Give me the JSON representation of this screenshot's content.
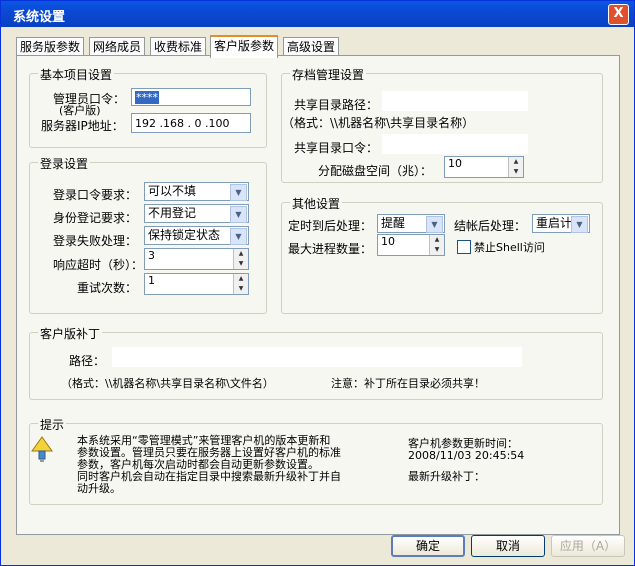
{
  "window": {
    "title": "系统设置",
    "close_glyph": "X"
  },
  "tabs": [
    "服务版参数",
    "网络成员",
    "收费标准",
    "客户版参数",
    "高级设置"
  ],
  "basic": {
    "title": "基本项目设置",
    "admin_pw_label": "管理员口令：",
    "admin_pw_sub": "(客户版)",
    "admin_pw_value": "****",
    "server_ip_label": "服务器IP地址：",
    "server_ip_value": "192 .168 . 0  .100"
  },
  "login": {
    "title": "登录设置",
    "pw_req_label": "登录口令要求：",
    "pw_req_value": "可以不填",
    "id_reg_label": "身份登记要求：",
    "id_reg_value": "不用登记",
    "fail_label": "登录失败处理：",
    "fail_value": "保持锁定状态",
    "timeout_label": "响应超时（秒）：",
    "timeout_value": "3",
    "retry_label": "重试次数：",
    "retry_value": "1"
  },
  "archive": {
    "title": "存档管理设置",
    "share_path_label": "共享目录路径：",
    "format_hint": "（格式：\\\\机器名称\\共享目录名称）",
    "share_pw_label": "共享目录口令：",
    "disk_label": "分配磁盘空间（兆）：",
    "disk_value": "10"
  },
  "other": {
    "title": "其他设置",
    "timer_label": "定时到后处理：",
    "timer_value": "提醒",
    "checkout_label": "结帐后处理：",
    "checkout_value": "重启计",
    "max_proc_label": "最大进程数量：",
    "max_proc_value": "10",
    "shell_label": "禁止Shell访问"
  },
  "patch": {
    "title": "客户版补丁",
    "path_label": "路径：",
    "format_hint": "（格式：\\\\机器名称\\共享目录名称\\文件名）",
    "note": "注意：补丁所在目录必须共享！"
  },
  "hint": {
    "title": "提示",
    "text1": "本系统采用“零管理模式”来管理客户机的版本更新和",
    "text2": "参数设置。管理员只要在服务器上设置好客户机的标准",
    "text3": "参数，客户机每次启动时都会自动更新参数设置。",
    "text4": "同时客户机会自动在指定目录中搜索最新升级补丁并自",
    "text5": "动升级。",
    "update_label": "客户机参数更新时间：",
    "update_value": "2008/11/03 20:45:54",
    "latest_patch_label": "最新升级补丁："
  },
  "buttons": {
    "ok": "确定",
    "cancel": "取消",
    "apply": "应用（A）"
  }
}
